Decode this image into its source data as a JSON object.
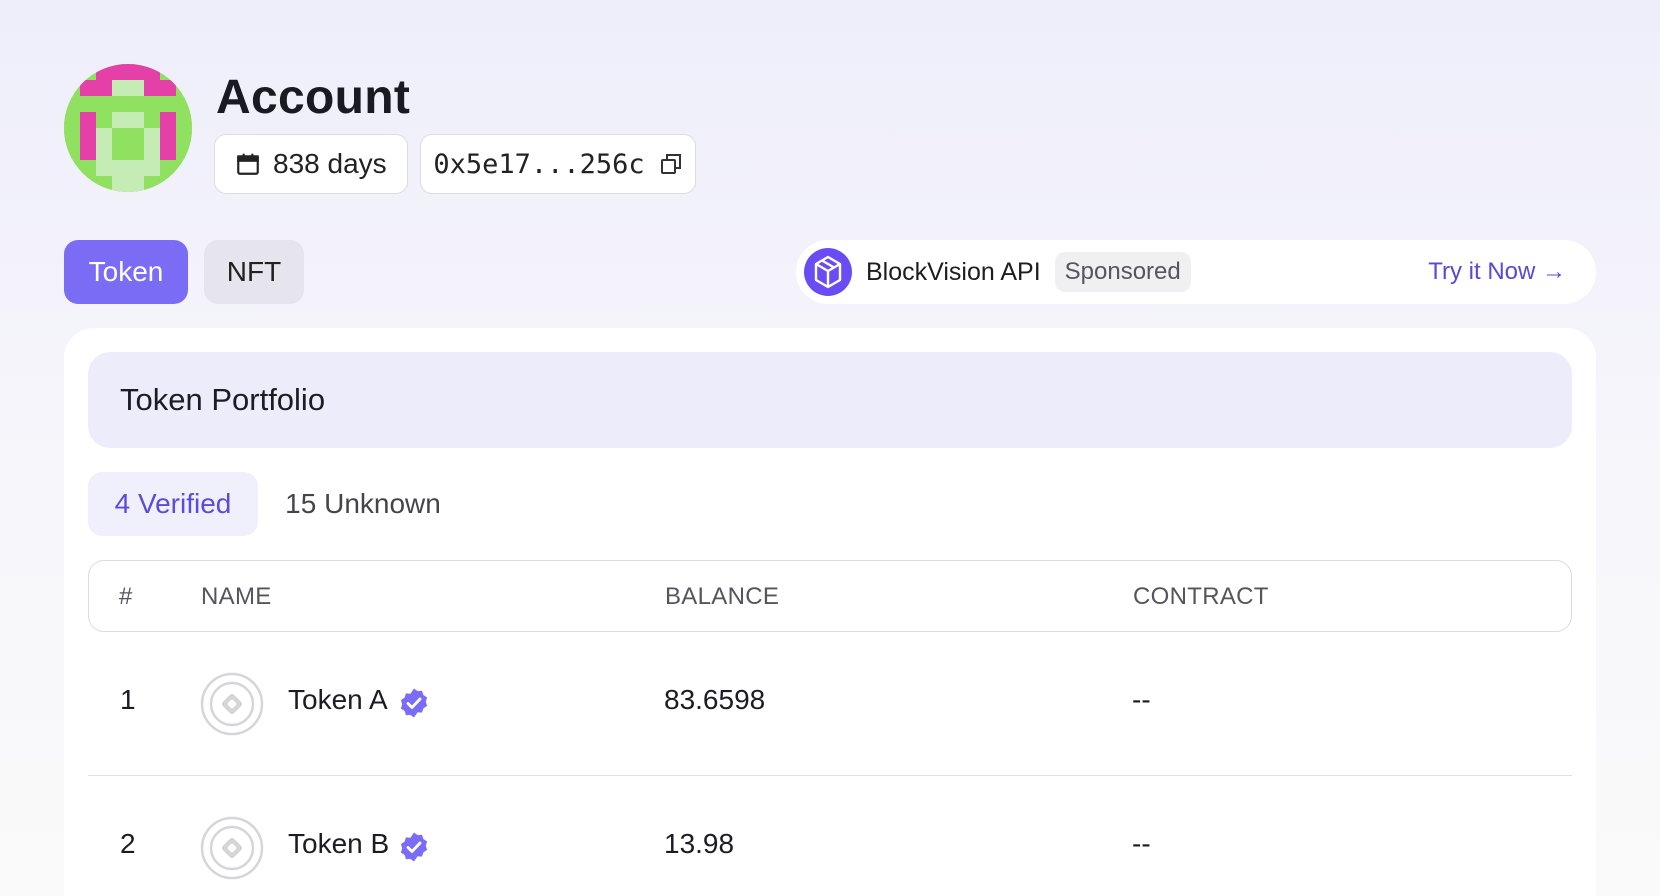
{
  "account": {
    "title": "Account",
    "age": "838 days",
    "address": "0x5e17...256c",
    "icons": {
      "age": "calendar-icon",
      "address": "copy-icon"
    }
  },
  "tabs": [
    {
      "label": "Token",
      "active": true
    },
    {
      "label": "NFT",
      "active": false
    }
  ],
  "sponsor": {
    "name": "BlockVision API",
    "badge": "Sponsored",
    "cta": "Try it Now →",
    "logo": "blockvision-logo-icon"
  },
  "portfolio": {
    "title": "Token Portfolio",
    "filters": [
      {
        "label": "4 Verified",
        "active": true
      },
      {
        "label": "15 Unknown",
        "active": false
      }
    ],
    "columns": [
      "#",
      "NAME",
      "BALANCE",
      "CONTRACT"
    ],
    "rows": [
      {
        "index": "1",
        "name": "Token A",
        "balance": "83.6598",
        "contract": "--",
        "verified": true
      },
      {
        "index": "2",
        "name": "Token B",
        "balance": "13.98",
        "contract": "--",
        "verified": true
      }
    ]
  },
  "colors": {
    "accent": "#7b6cf6",
    "accent_text": "#5b4bd6",
    "verified_badge": "#7b6cf6",
    "sponsor_logo": "#6a4cf5"
  }
}
